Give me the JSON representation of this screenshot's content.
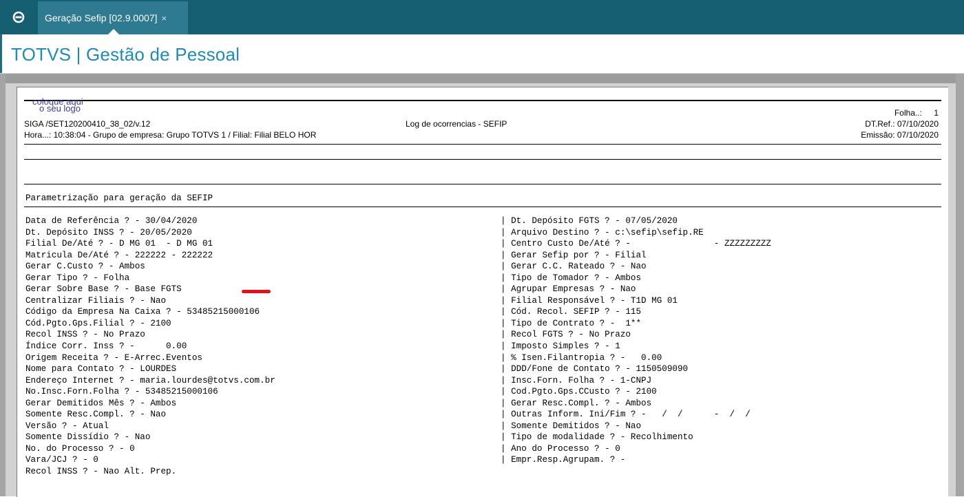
{
  "tab": {
    "label": "Geração Sefip [02.9.0007]",
    "close_symbol": "×"
  },
  "app_title": "TOTVS | Gestão de Pessoal",
  "report": {
    "logo_line1": "coloque aqui",
    "logo_line2": "o seu logo",
    "folha_label": "Folha..:",
    "folha_value": "1",
    "program": "SIGA /SET120200410_38_02/v.12",
    "report_title": "Log de ocorrencias - SEFIP",
    "dt_ref": "DT.Ref.: 07/10/2020",
    "hora_line": "Hora...: 10:38:04 - Grupo de empresa: Grupo TOTVS 1 / Filial: Filial BELO HOR",
    "emissao": "Emissão: 07/10/2020",
    "section_title": "Parametrização para geração da SEFIP",
    "left_params": [
      "Data de Referência ? - 30/04/2020",
      "Dt. Depósito INSS ? - 20/05/2020",
      "Filial De/Até ? - D MG 01  - D MG 01",
      "Matricula De/Até ? - 222222 - 222222",
      "Gerar C.Custo ? - Ambos",
      "Gerar Tipo ? - Folha",
      "Gerar Sobre Base ? - Base FGTS",
      "Centralizar Filiais ? - Nao",
      "Código da Empresa Na Caixa ? - 53485215000106",
      "Cód.Pgto.Gps.Filial ? - 2100",
      "Recol INSS ? - No Prazo",
      "Índice Corr. Inss ? -      0.00",
      "Origem Receita ? - E-Arrec.Eventos",
      "Nome para Contato ? - LOURDES",
      "Endereço Internet ? - maria.lourdes@totvs.com.br",
      "No.Insc.Forn.Folha ? - 53485215000106",
      "Gerar Demitidos Mês ? - Ambos",
      "Somente Resc.Compl. ? - Nao",
      "Versão ? - Atual",
      "Somente Dissídio ? - Nao",
      "No. do Processo ? - 0",
      "Vara/JCJ ? - 0",
      "Recol INSS ? - Nao Alt. Prep."
    ],
    "right_params": [
      "| Dt. Depósito FGTS ? - 07/05/2020",
      "| Arquivo Destino ? - c:\\sefip\\sefip.RE",
      "| Centro Custo De/Até ? -                - ZZZZZZZZZ",
      "| Gerar Sefip por ? - Filial",
      "| Gerar C.C. Rateado ? - Nao",
      "| Tipo de Tomador ? - Ambos",
      "| Agrupar Empresas ? - Nao",
      "| Filial Responsável ? - T1D MG 01",
      "| Cód. Recol. SEFIP ? - 115",
      "| Tipo de Contrato ? -  1**",
      "| Recol FGTS ? - No Prazo",
      "| Imposto Simples ? - 1",
      "| % Isen.Filantropia ? -   0.00",
      "| DDD/Fone de Contato ? - 1150509090",
      "| Insc.Forn. Folha ? - 1-CNPJ",
      "| Cod.Pgto.Gps.CCusto ? - 2100",
      "| Gerar Resc.Compl. ? - Ambos",
      "| Outras Inform. Ini/Fim ? -   /  /      -  /  /",
      "| Somente Demitidos ? - Nao",
      "| Tipo de modalidade ? - Recolhimento",
      "| Ano do Processo ? - 0",
      "| Empr.Resp.Agrupam. ? -"
    ]
  },
  "colors": {
    "tabbar": "#165f73",
    "tab_active": "#2d7a91",
    "title": "#1f8bb7",
    "redaction": "#e0121a"
  }
}
